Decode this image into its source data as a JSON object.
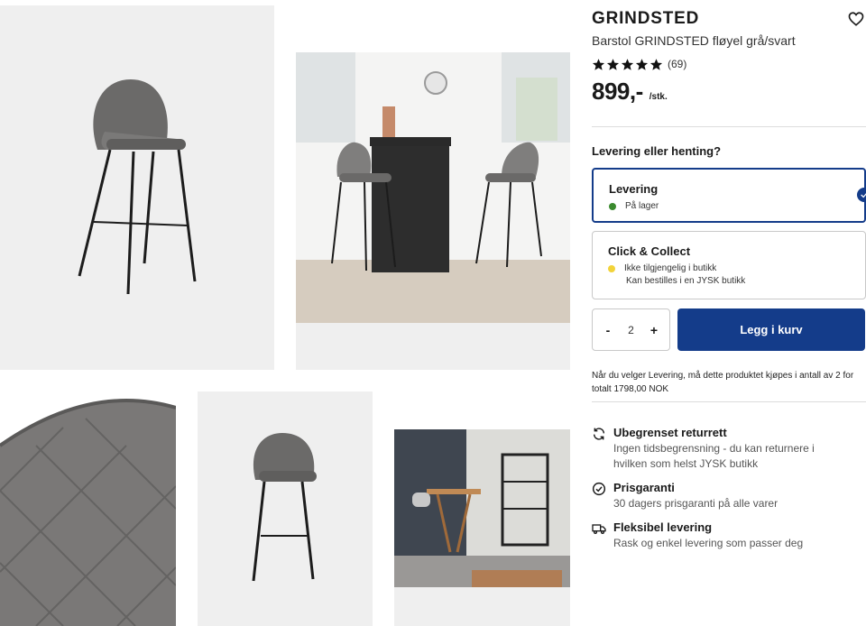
{
  "product": {
    "title": "GRINDSTED",
    "subtitle": "Barstol GRINDSTED fløyel grå/svart",
    "review_count": "(69)",
    "rating_stars": 5,
    "price": "899,-",
    "unit": "/stk."
  },
  "delivery": {
    "heading": "Levering eller henting?",
    "options": [
      {
        "title": "Levering",
        "status": "På lager",
        "status_color": "#3a8a2e",
        "selected": true
      },
      {
        "title": "Click & Collect",
        "status": "Ikke tilgjengelig i butikk",
        "status_sub": "Kan bestilles i en JYSK butikk",
        "status_color": "#f2d33a",
        "selected": false
      }
    ]
  },
  "quantity": {
    "minus": "-",
    "value": "2",
    "plus": "+"
  },
  "cart_button": "Legg i kurv",
  "note": "Når du velger Levering, må dette produktet kjøpes i antall av 2 for totalt 1798,00 NOK",
  "benefits": [
    {
      "icon": "refresh-icon",
      "title": "Ubegrenset returrett",
      "desc": "Ingen tidsbegrensning - du kan returnere i hvilken som helst JYSK butikk"
    },
    {
      "icon": "check-circle-icon",
      "title": "Prisgaranti",
      "desc": "30 dagers prisgaranti på alle varer"
    },
    {
      "icon": "truck-icon",
      "title": "Fleksibel levering",
      "desc": "Rask og enkel levering som passer deg"
    }
  ],
  "colors": {
    "brand": "#143c8a",
    "in_stock": "#3a8a2e",
    "not_in_store": "#f2d33a"
  },
  "gallery": [
    "product-photo-front",
    "product-photo-room",
    "product-photo-fabric-detail",
    "product-photo-side",
    "product-photo-interior"
  ]
}
